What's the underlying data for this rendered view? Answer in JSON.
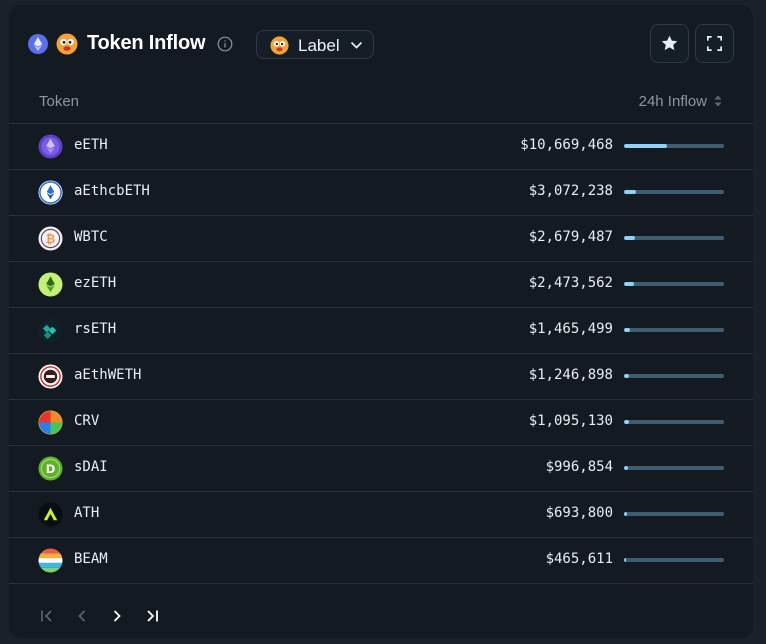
{
  "header": {
    "title": "Token Inflow",
    "label_button": "Label",
    "icons": {
      "chain": "ethereum-icon",
      "entity": "face-icon",
      "info": "info-icon",
      "star": "star-icon",
      "expand": "expand-icon",
      "chevron": "chevron-down-icon"
    }
  },
  "table": {
    "col_token": "Token",
    "col_inflow": "24h Inflow",
    "rows": [
      {
        "name": "eETH",
        "value": "$10,669,468",
        "share": 0.43,
        "icon": "eeth-icon"
      },
      {
        "name": "aEthcbETH",
        "value": "$3,072,238",
        "share": 0.12,
        "icon": "aethcbeth-icon"
      },
      {
        "name": "WBTC",
        "value": "$2,679,487",
        "share": 0.11,
        "icon": "wbtc-icon"
      },
      {
        "name": "ezETH",
        "value": "$2,473,562",
        "share": 0.1,
        "icon": "ezeth-icon"
      },
      {
        "name": "rsETH",
        "value": "$1,465,499",
        "share": 0.06,
        "icon": "rseth-icon"
      },
      {
        "name": "aEthWETH",
        "value": "$1,246,898",
        "share": 0.05,
        "icon": "aethweth-icon"
      },
      {
        "name": "CRV",
        "value": "$1,095,130",
        "share": 0.045,
        "icon": "crv-icon"
      },
      {
        "name": "sDAI",
        "value": "$996,854",
        "share": 0.04,
        "icon": "sdai-icon"
      },
      {
        "name": "ATH",
        "value": "$693,800",
        "share": 0.03,
        "icon": "ath-icon"
      },
      {
        "name": "BEAM",
        "value": "$465,611",
        "share": 0.02,
        "icon": "beam-icon"
      }
    ]
  },
  "colors": {
    "bar_fill": "#8bd3f7",
    "bar_track": "#3f5d70",
    "panel": "#131a22"
  }
}
